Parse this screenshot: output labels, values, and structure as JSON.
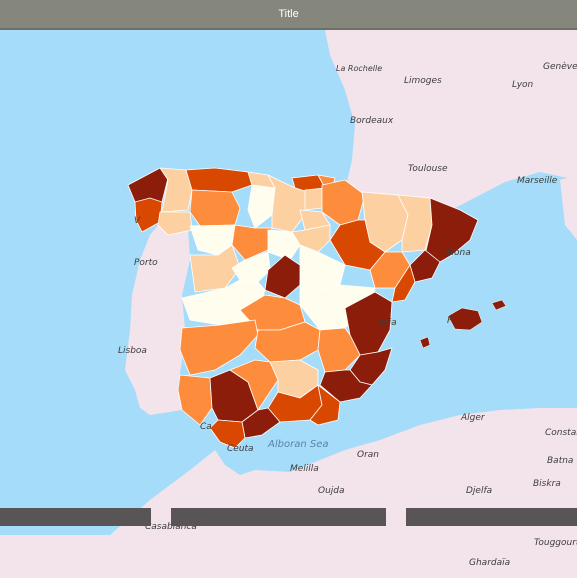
{
  "window": {
    "title": "Title"
  },
  "map": {
    "region": "Iberian Peninsula and surroundings",
    "colors": {
      "sea": "#a5dcfa",
      "land": "#f3e4ec",
      "scale": [
        "#fffdee",
        "#fdd0a2",
        "#fd8d3c",
        "#d94801",
        "#8c1d0a"
      ]
    },
    "labels": {
      "la_rochelle": "La Rochelle",
      "limoges": "Limoges",
      "lyon": "Lyon",
      "geneve": "Genève",
      "bordeaux": "Bordeaux",
      "toulouse": "Toulouse",
      "marseille": "Marseille",
      "porto": "Porto",
      "lisboa": "Lisboa",
      "barcelona_partial": "elona",
      "valencia_partial": "ncia",
      "palma_partial": "P",
      "alboran_sea": "Alboran Sea",
      "ceuta": "Ceuta",
      "melilla": "Melilla",
      "oran": "Oran",
      "alger": "Alger",
      "constantine_partial": "Constar",
      "batna": "Batna",
      "biskra": "Biskra",
      "oujda": "Oujda",
      "djelfa": "Djelfa",
      "casablanca": "Casablanca",
      "touggourt": "Touggourt",
      "ghardaia": "Ghardaïa",
      "cadiz_partial": "Ca",
      "vigo_partial": "V"
    }
  }
}
